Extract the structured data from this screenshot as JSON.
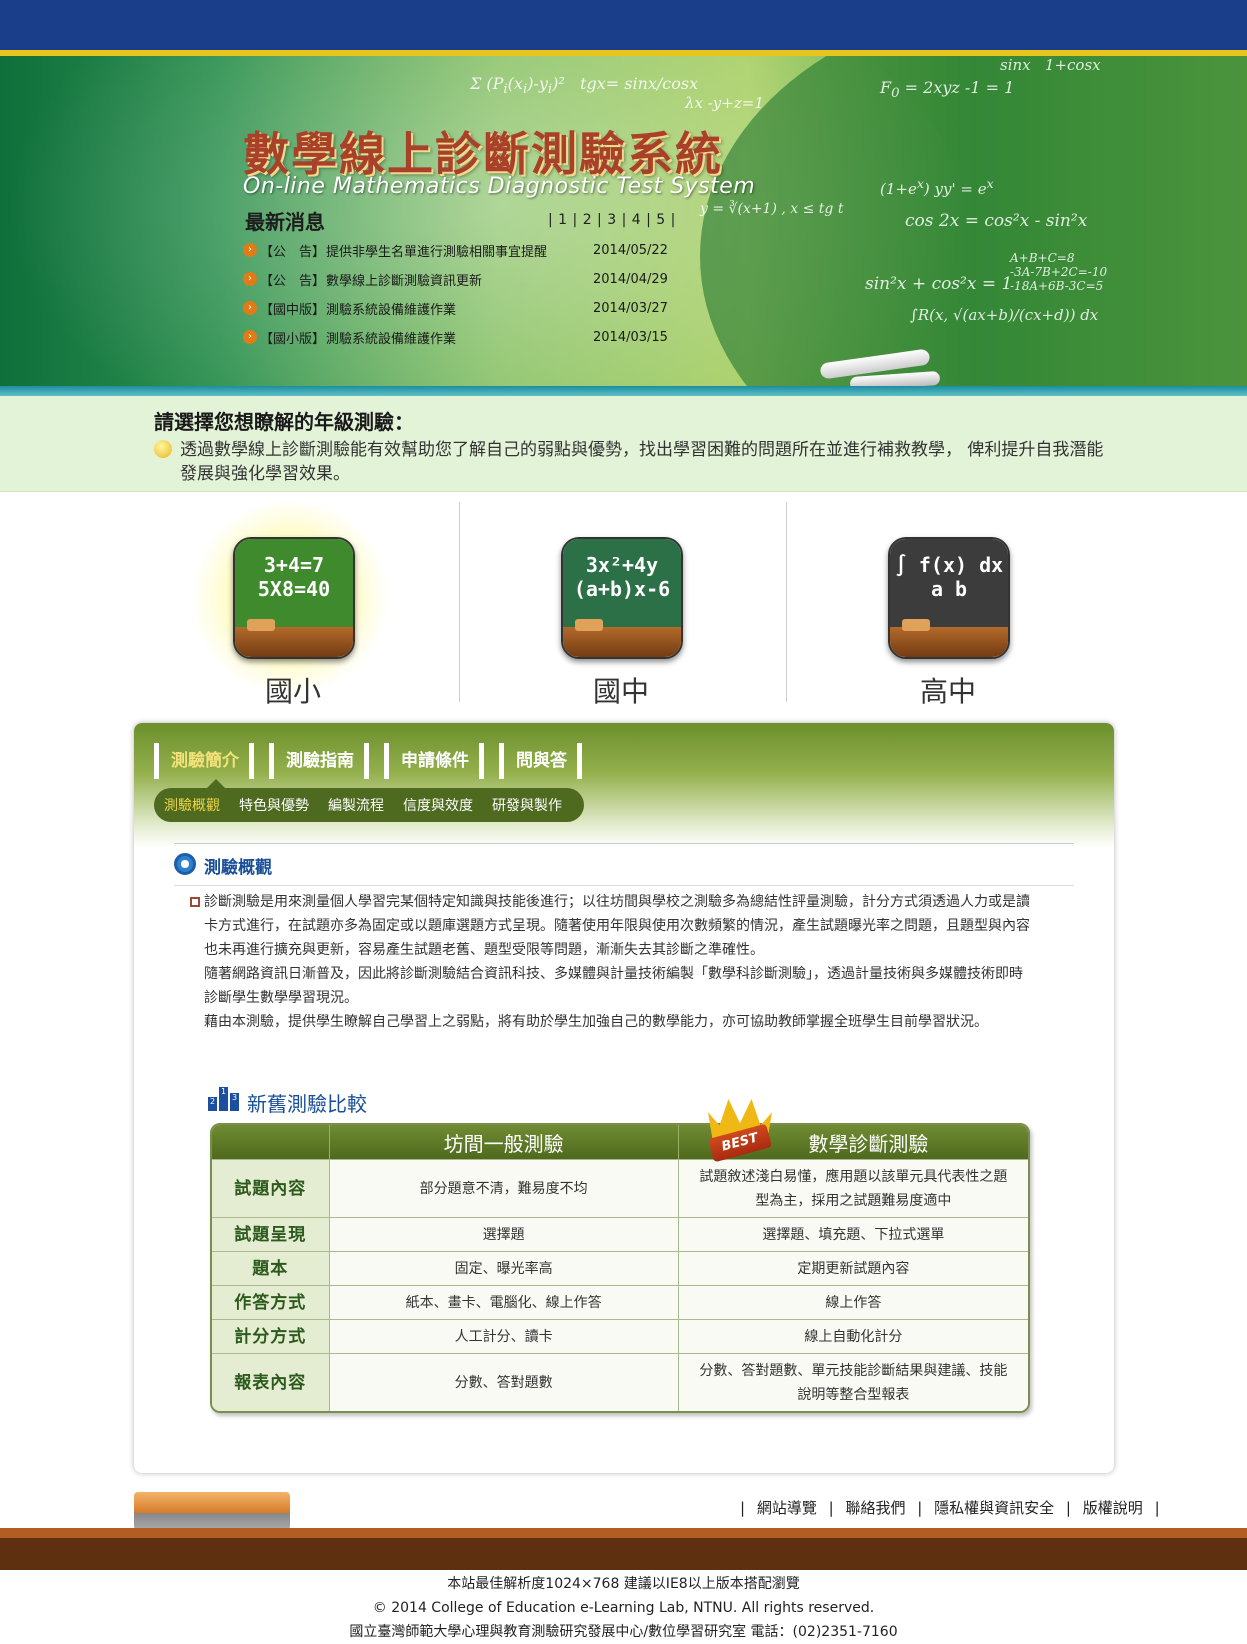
{
  "site": {
    "title": "數學線上診斷測驗系統",
    "subtitle": "On-line Mathematics Diagnostic Test System"
  },
  "news": {
    "title": "最新消息",
    "pages": "| 1 | 2 | 3 | 4 | 5 |",
    "items": [
      {
        "category": "【公　告】",
        "text": "提供非學生名單進行測驗相關事宜提醒",
        "date": "2014/05/22"
      },
      {
        "category": "【公　告】",
        "text": "數學線上診斷測驗資訊更新",
        "date": "2014/04/29"
      },
      {
        "category": "【國中版】",
        "text": "測驗系統設備維護作業",
        "date": "2014/03/27"
      },
      {
        "category": "【國小版】",
        "text": "測驗系統設備維護作業",
        "date": "2014/03/15"
      }
    ]
  },
  "intro": {
    "heading": "請選擇您想瞭解的年級測驗：",
    "text": "透過數學線上診斷測驗能有效幫助您了解自己的弱點與優勢，找出學習困難的問題所在並進行補救教學， 俾利提升自我潛能發展與強化學習效果。"
  },
  "grades": [
    {
      "label": "國小",
      "board_line1": "3+4=7",
      "board_line2": "5X8=40",
      "board_color": "#3f8a2c"
    },
    {
      "label": "國中",
      "board_line1": "3x²+4y",
      "board_line2": "(a+b)x-6",
      "board_color": "#2c7048"
    },
    {
      "label": "高中",
      "board_line1": "∫ f(x) dx",
      "board_line2": "a  b",
      "board_color": "#3c3c3c"
    }
  ],
  "tabs": {
    "main": [
      "測驗簡介",
      "測驗指南",
      "申請條件",
      "問與答"
    ],
    "sub": [
      "測驗概觀",
      "特色與優勢",
      "編製流程",
      "信度與效度",
      "研發與製作"
    ]
  },
  "section": {
    "title": "測驗概觀",
    "paragraphs": [
      "診斷測驗是用來測量個人學習完某個特定知識與技能後進行；以往坊間與學校之測驗多為總結性評量測驗，計分方式須透過人力或是讀卡方式進行，在試題亦多為固定或以題庫選題方式呈現。隨著使用年限與使用次數頻繁的情況，產生試題曝光率之問題，且題型與內容也未再進行擴充與更新，容易產生試題老舊、題型受限等問題，漸漸失去其診斷之準確性。",
      "隨著網路資訊日漸普及，因此將診斷測驗結合資訊科技、多媒體與計量技術編製「數學科診斷測驗」，透過計量技術與多媒體技術即時診斷學生數學學習現況。",
      "藉由本測驗，提供學生瞭解自己學習上之弱點，將有助於學生加強自己的數學能力，亦可協助教師掌握全班學生目前學習狀況。"
    ]
  },
  "comparison": {
    "title": "新舊測驗比較",
    "icon_digits": [
      "2",
      "1",
      "3"
    ],
    "best_badge": "BEST",
    "col_old": "坊間一般測驗",
    "col_new": "數學診斷測驗",
    "rows": [
      {
        "item": "試題內容",
        "old": "部分題意不清，難易度不均",
        "new": "試題敘述淺白易懂，應用題以該單元具代表性之題型為主，採用之試題難易度適中"
      },
      {
        "item": "試題呈現",
        "old": "選擇題",
        "new": "選擇題、填充題、下拉式選單"
      },
      {
        "item": "題本",
        "old": "固定、曝光率高",
        "new": "定期更新試題內容"
      },
      {
        "item": "作答方式",
        "old": "紙本、畫卡、電腦化、線上作答",
        "new": "線上作答"
      },
      {
        "item": "計分方式",
        "old": "人工計分、讀卡",
        "new": "線上自動化計分"
      },
      {
        "item": "報表內容",
        "old": "分數、答對題數",
        "new": "分數、答對題數、單元技能診斷結果與建議、技能說明等整合型報表"
      }
    ]
  },
  "footer": {
    "links": [
      "網站導覽",
      "聯絡我們",
      "隱私權與資訊安全",
      "版權說明"
    ],
    "line1": "本站最佳解析度1024×768 建議以IE8以上版本搭配瀏覽",
    "line2": "© 2014 College of Education e-Learning Lab, NTNU. All rights reserved.",
    "line3": "國立臺灣師範大學心理與教育測驗研究發展中心/數位學習研究室 電話：(02)2351-7160"
  }
}
